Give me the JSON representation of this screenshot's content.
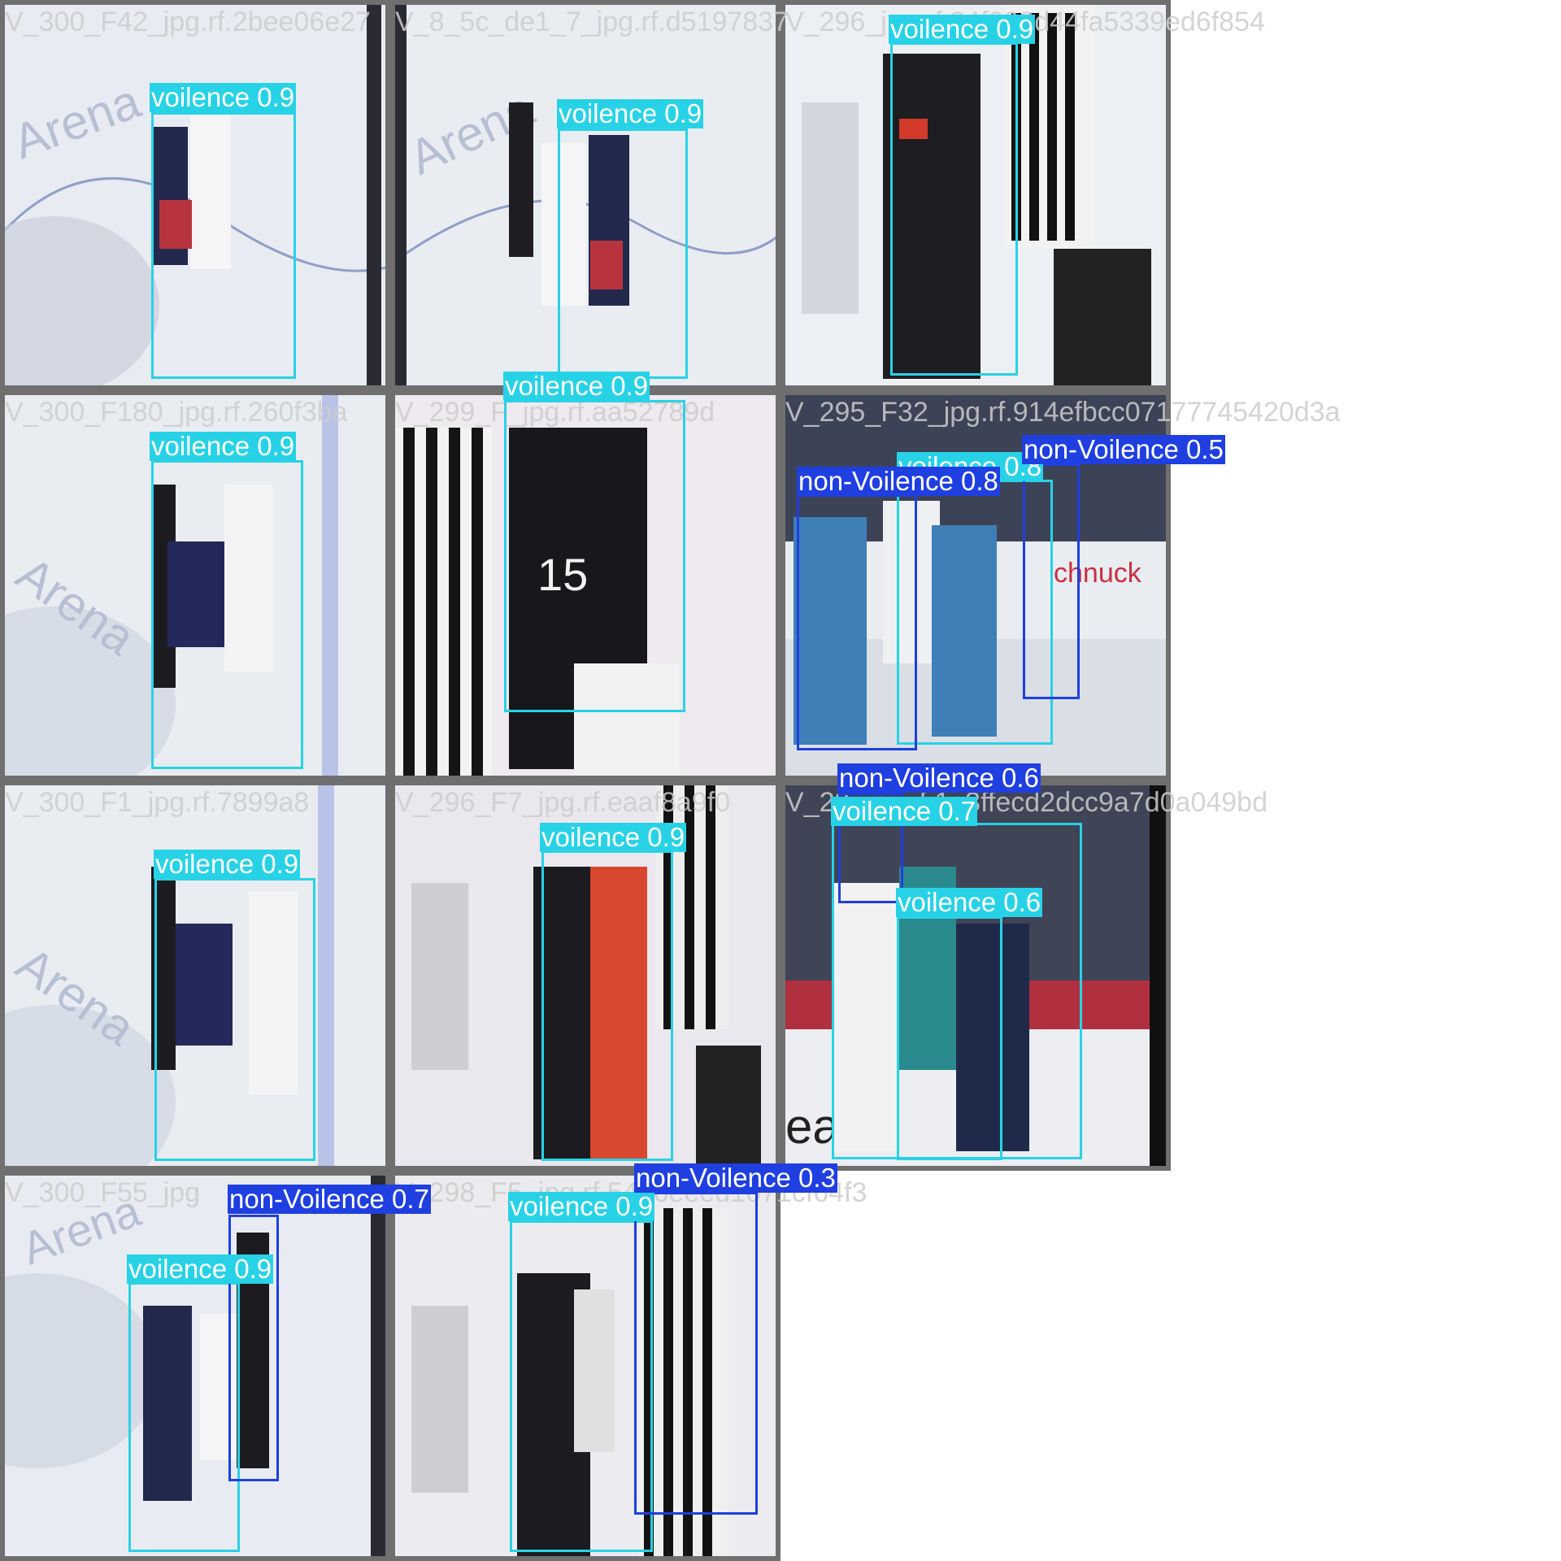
{
  "colors": {
    "violence": "#28d2e6",
    "non_violence": "#1f3fe0",
    "tile_border": "#6f6f6f"
  },
  "tiles": [
    {
      "filename": "V_300_F42_jpg.rf.2bee06e27"
    },
    {
      "filename": "V_8_5c_de1_7_jpg.rf.d5197837"
    },
    {
      "filename": "V_296_jpg.rf.34f900d44fa5339ed6f854"
    },
    {
      "filename": "V_300_F180_jpg.rf.260f3ba"
    },
    {
      "filename": "V_299_F_jpg.rf.aa52789d"
    },
    {
      "filename": "V_295_F32_jpg.rf.914efbcc07177745420d3a"
    },
    {
      "filename": "V_300_F1_jpg.rf.7899a8"
    },
    {
      "filename": "V_296_F7_jpg.rf.eaaf8a9f0"
    },
    {
      "filename": "V_29_jpg.rf.1e3ffecd2dcc9a7d0a049bd"
    },
    {
      "filename": "V_300_F55_jpg"
    },
    {
      "filename": "V_298_F5_jpg.rf.5466eeed1671cf64f3"
    }
  ],
  "detections": [
    {
      "label": "voilence 0.9"
    },
    {
      "label": "voilence 0.9"
    },
    {
      "label": "voilence 0.9"
    },
    {
      "label": "voilence 0.9"
    },
    {
      "label": "voilence 0.9"
    },
    {
      "label": "voilence 0.8"
    },
    {
      "label": "non-Voilence 0.8"
    },
    {
      "label": "non-Voilence 0.5"
    },
    {
      "label": "voilence 0.9"
    },
    {
      "label": "voilence 0.9"
    },
    {
      "label": "non-Voilence 0.6"
    },
    {
      "label": "voilence 0.7"
    },
    {
      "label": "voilence 0.6"
    },
    {
      "label": "voilence 0.9"
    },
    {
      "label": "non-Voilence 0.7"
    },
    {
      "label": "voilence 0.9"
    },
    {
      "label": "non-Voilence 0.3"
    }
  ]
}
